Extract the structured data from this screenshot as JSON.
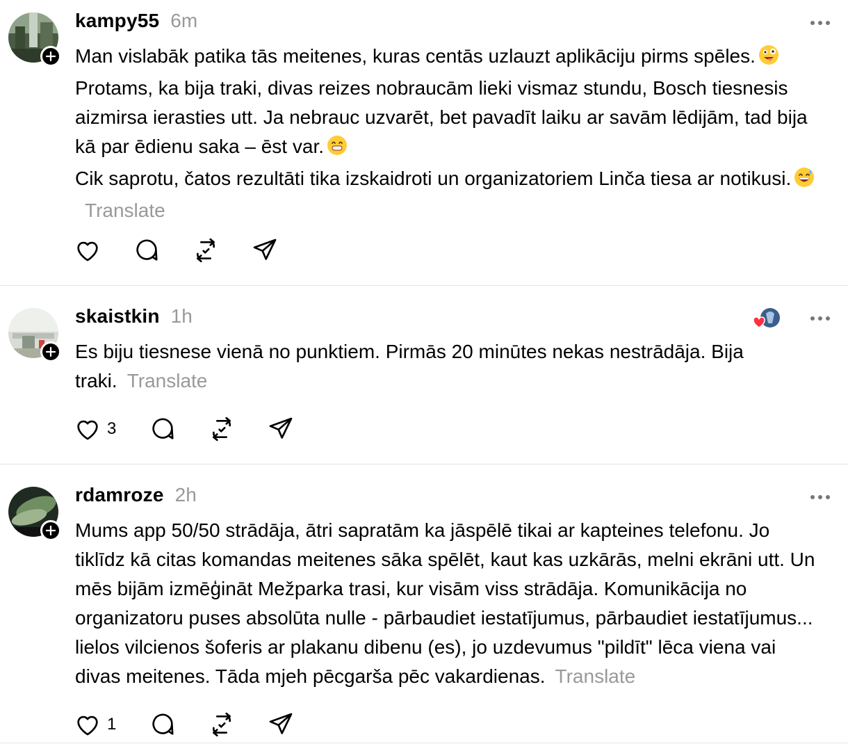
{
  "posts": [
    {
      "username": "kampy55",
      "time": "6m",
      "lines": [
        "Man vislabāk patika tās meitenes, kuras centās uzlauzt aplikāciju pirms spēles.",
        "Protams, ka bija traki, divas reizes nobraucām lieki vismaz stundu, Bosch tiesnesis aizmirsa ierasties utt. Ja nebrauc uzvarēt, bet pavadīt laiku ar savām lēdijām, tad bija kā par ēdienu saka – ēst var.",
        "Cik saprotu, čatos rezultāti tika izskaidroti un organizatoriem Linča tiesa ar notikusi."
      ],
      "emojis": [
        "zany-face-emoji",
        "grinning-teeth-emoji",
        "grinning-sweat-emoji"
      ],
      "translate": "Translate",
      "like_count": ""
    },
    {
      "username": "skaistkin",
      "time": "1h",
      "lines": [
        "Es biju tiesnese vienā no punktiem. Pirmās 20 minūtes nekas nestrādāja. Bija traki."
      ],
      "translate": "Translate",
      "like_count": "3"
    },
    {
      "username": "rdamroze",
      "time": "2h",
      "lines": [
        "Mums app 50/50 strādāja, ātri sapratām ka jāspēlē tikai ar kapteines telefonu. Jo tiklīdz kā citas komandas meitenes sāka spēlēt, kaut kas uzkārās, melni ekrāni utt. Un mēs bijām izmēģināt Mežparka trasi, kur visām viss strādāja. Komunikācija no organizatoru puses absolūta nulle - pārbaudiet iestatījumus, pārbaudiet iestatījumus... lielos vilcienos šoferis ar plakanu dibenu (es), jo uzdevumus \"pildīt\" lēca viena vai divas meitenes. Tāda mjeh pēcgarša pēc vakardienas."
      ],
      "translate": "Translate",
      "like_count": "1"
    }
  ],
  "icons": {
    "like": "heart-icon",
    "reply": "comment-bubble-icon",
    "repost": "repost-icon",
    "share": "send-icon",
    "more": "more-options-icon",
    "follow": "plus-icon"
  },
  "colors": {
    "text": "#000000",
    "muted": "#999999",
    "divider": "#e5e5e5",
    "heart_red": "#ff3040"
  }
}
